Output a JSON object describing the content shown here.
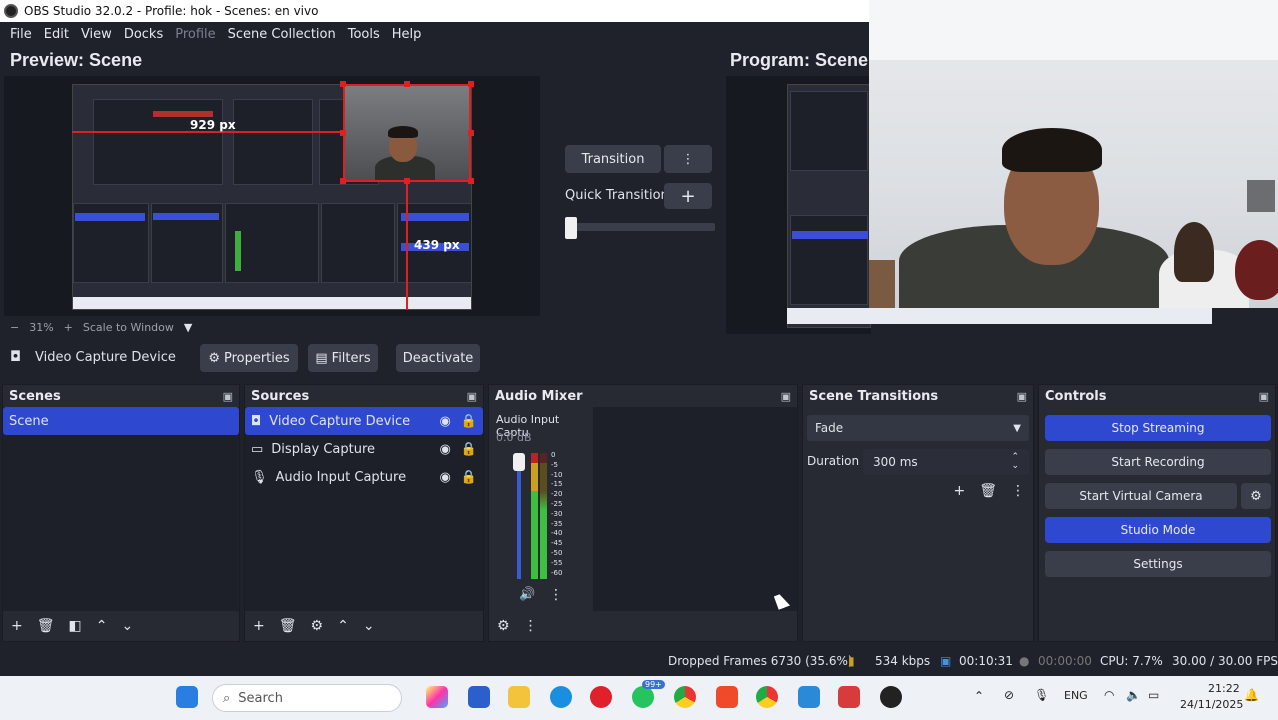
{
  "window": {
    "title": "OBS Studio 32.0.2 - Profile: hok - Scenes: en vivo"
  },
  "menu": [
    "File",
    "Edit",
    "View",
    "Docks",
    "Profile",
    "Scene Collection",
    "Tools",
    "Help"
  ],
  "preview": {
    "title": "Preview: Scene",
    "measure_h": "929 px",
    "measure_v": "439 px",
    "zoom": "31%",
    "zoom_mode": "Scale to Window"
  },
  "program": {
    "title": "Program: Scene"
  },
  "transition": {
    "button": "Transition",
    "quick_label": "Quick Transitions",
    "tbar_level": 0.0
  },
  "context": {
    "source_name": "Video Capture Device",
    "properties": "Properties",
    "filters": "Filters",
    "deactivate": "Deactivate"
  },
  "scenes": {
    "title": "Scenes",
    "items": [
      "Scene"
    ]
  },
  "sources": {
    "title": "Sources",
    "items": [
      {
        "name": "Video Capture Device",
        "icon": "camera-icon",
        "selected": true
      },
      {
        "name": "Display Capture",
        "icon": "monitor-icon",
        "selected": false
      },
      {
        "name": "Audio Input Capture",
        "icon": "microphone-icon",
        "selected": false
      }
    ]
  },
  "mixer": {
    "title": "Audio Mixer",
    "channel": "Audio Input Captu",
    "db": "0.0 dB",
    "scale": [
      "0",
      "-5",
      "-10",
      "-15",
      "-20",
      "-25",
      "-30",
      "-35",
      "-40",
      "-45",
      "-50",
      "-55",
      "-60"
    ]
  },
  "transitions": {
    "title": "Scene Transitions",
    "selected": "Fade",
    "duration_label": "Duration",
    "duration_value": "300 ms"
  },
  "controls": {
    "title": "Controls",
    "stop_streaming": "Stop Streaming",
    "start_recording": "Start Recording",
    "start_virtual_camera": "Start Virtual Camera",
    "studio_mode": "Studio Mode",
    "settings": "Settings"
  },
  "status": {
    "dropped": "Dropped Frames 6730 (35.6%)",
    "bitrate": "534 kbps",
    "stream_time": "00:10:31",
    "rec_time": "00:00:00",
    "cpu": "CPU: 7.7%",
    "fps": "30.00 / 30.00 FPS"
  },
  "taskbar": {
    "search": "Search",
    "lang": "ENG",
    "time": "21:22",
    "date": "24/11/2025",
    "badge": "99+"
  },
  "colors": {
    "accent": "#2f48d0",
    "bg": "#1f222b",
    "panel": "#272a33",
    "red": "#e02020"
  }
}
